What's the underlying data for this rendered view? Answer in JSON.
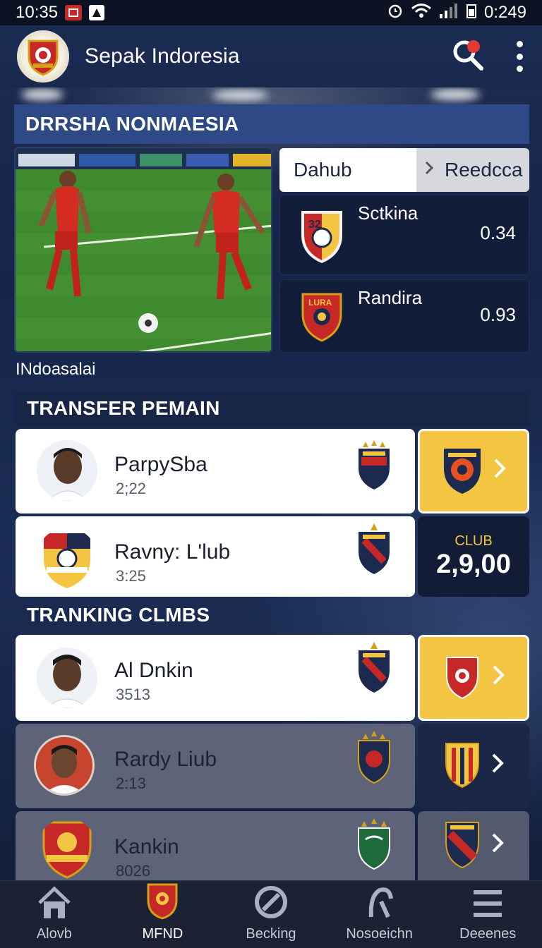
{
  "status_bar": {
    "time": "10:35",
    "right_text": "0:249",
    "icons": [
      "notification-icon",
      "app-icon",
      "alarm-icon",
      "wifi-icon",
      "signal-icon",
      "battery-icon"
    ]
  },
  "app_bar": {
    "title": "Sepak Indoresia",
    "icons": [
      "club-logo-icon",
      "search-icon",
      "more-icon"
    ]
  },
  "featured": {
    "header": "DRRSHA NONMAESIA",
    "caption": "INdoasalai",
    "tabs": [
      {
        "label": "Dahub",
        "active": true
      },
      {
        "label": "Reedcca",
        "active": false
      }
    ],
    "scores": [
      {
        "team": "Sctkina",
        "value": "0.34",
        "crest_text": "32"
      },
      {
        "team": "Randira",
        "value": "0.93",
        "crest_text": "LURA"
      }
    ]
  },
  "transfers": {
    "header": "TRANSFER PEMAIN",
    "rows": [
      {
        "name": "ParpySba",
        "meta": "2;22",
        "side": "yellow"
      },
      {
        "name": "Ravny: L'lub",
        "meta": "3:25",
        "side": "club"
      }
    ],
    "club_box": {
      "label": "CLUB",
      "value": "2,9,00"
    }
  },
  "ranking": {
    "header": "TRANKING CLMBS",
    "rows": [
      {
        "name": "Al Dnkin",
        "meta": "3513",
        "side": "yellow"
      },
      {
        "name": "Rardy Liub",
        "meta": "2:13",
        "side": "dark"
      },
      {
        "name": "Kankin",
        "meta": "8026",
        "side": "gray"
      }
    ]
  },
  "bottom_nav": [
    {
      "label": "Alovb",
      "icon": "home-icon",
      "active": false
    },
    {
      "label": "MFND",
      "icon": "crest-icon",
      "active": true
    },
    {
      "label": "Becking",
      "icon": "ban-icon",
      "active": false
    },
    {
      "label": "Nosoeichn",
      "icon": "person-icon",
      "active": false
    },
    {
      "label": "Deeenes",
      "icon": "menu-icon",
      "active": false
    }
  ],
  "colors": {
    "accent_yellow": "#f4c542",
    "header_blue": "#2e4a86",
    "background": "#15254a",
    "crest_red": "#c62828"
  }
}
